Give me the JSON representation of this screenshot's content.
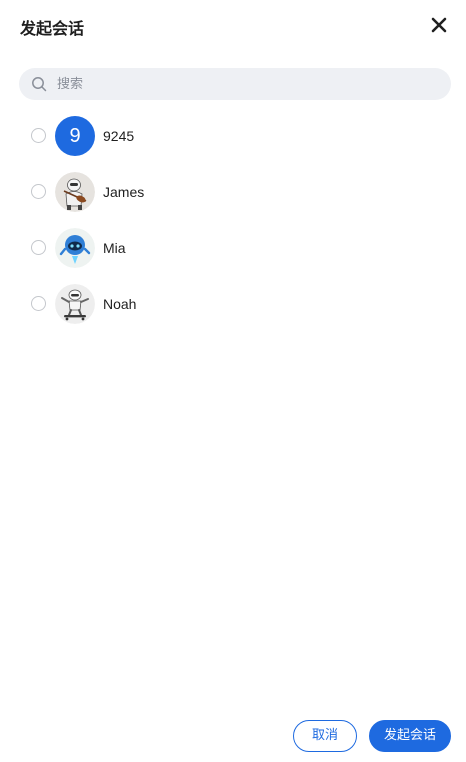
{
  "dialog": {
    "title": "发起会话",
    "close_icon": "close-icon"
  },
  "search": {
    "placeholder": "搜索",
    "value": "",
    "icon": "search-icon"
  },
  "contacts": [
    {
      "name": "9245",
      "avatar_letter": "9",
      "avatar_color": "#1e6ae0",
      "selected": false
    },
    {
      "name": "James",
      "avatar_image": "violinist-robot-avatar",
      "selected": false
    },
    {
      "name": "Mia",
      "avatar_image": "blue-robot-avatar",
      "selected": false
    },
    {
      "name": "Noah",
      "avatar_image": "skateboard-robot-avatar",
      "selected": false
    }
  ],
  "footer": {
    "cancel_label": "取消",
    "confirm_label": "发起会话"
  },
  "colors": {
    "accent": "#1e6ae0",
    "search_bg": "#eef0f4"
  }
}
